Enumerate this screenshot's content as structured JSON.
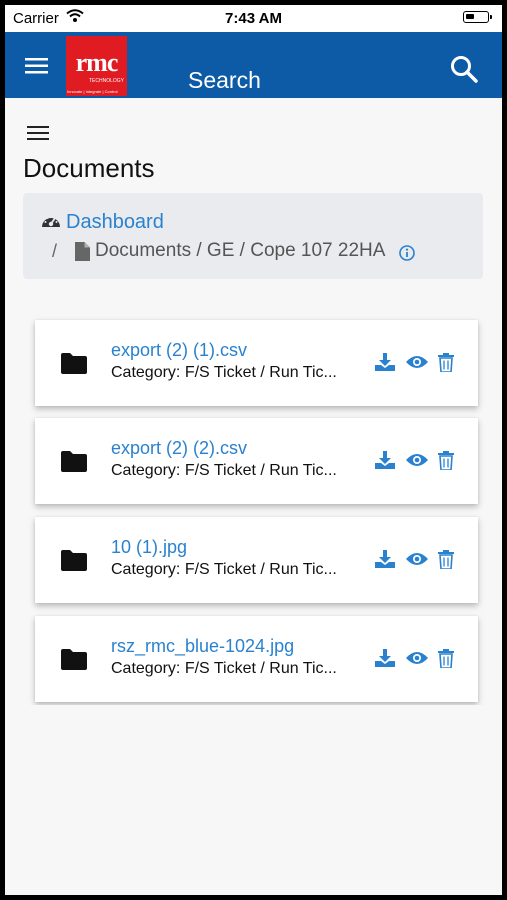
{
  "status_bar": {
    "carrier": "Carrier",
    "time": "7:43 AM"
  },
  "app_bar": {
    "logo_text": "rmc",
    "logo_subtext": "TECHNOLOGY",
    "logo_tagline": "Innovate | Integrate | Control",
    "title": "Search"
  },
  "page": {
    "title": "Documents"
  },
  "breadcrumb": {
    "dashboard": "Dashboard",
    "separator": "/",
    "path": "Documents / GE / Cope 107 22HA"
  },
  "documents": [
    {
      "name": "export (2) (1).csv",
      "category": "Category: F/S Ticket / Run Tic..."
    },
    {
      "name": "export (2) (2).csv",
      "category": "Category: F/S Ticket / Run Tic..."
    },
    {
      "name": "10 (1).jpg",
      "category": "Category: F/S Ticket / Run Tic..."
    },
    {
      "name": "rsz_rmc_blue-1024.jpg",
      "category": "Category: F/S Ticket / Run Tic..."
    }
  ],
  "colors": {
    "header": "#0d5aa7",
    "link": "#2a82cf",
    "logo": "#e11b22"
  },
  "icons": [
    "menu-icon",
    "search-icon",
    "dashboard-icon",
    "document-icon",
    "info-icon",
    "folder-icon",
    "download-icon",
    "eye-icon",
    "trash-icon"
  ]
}
